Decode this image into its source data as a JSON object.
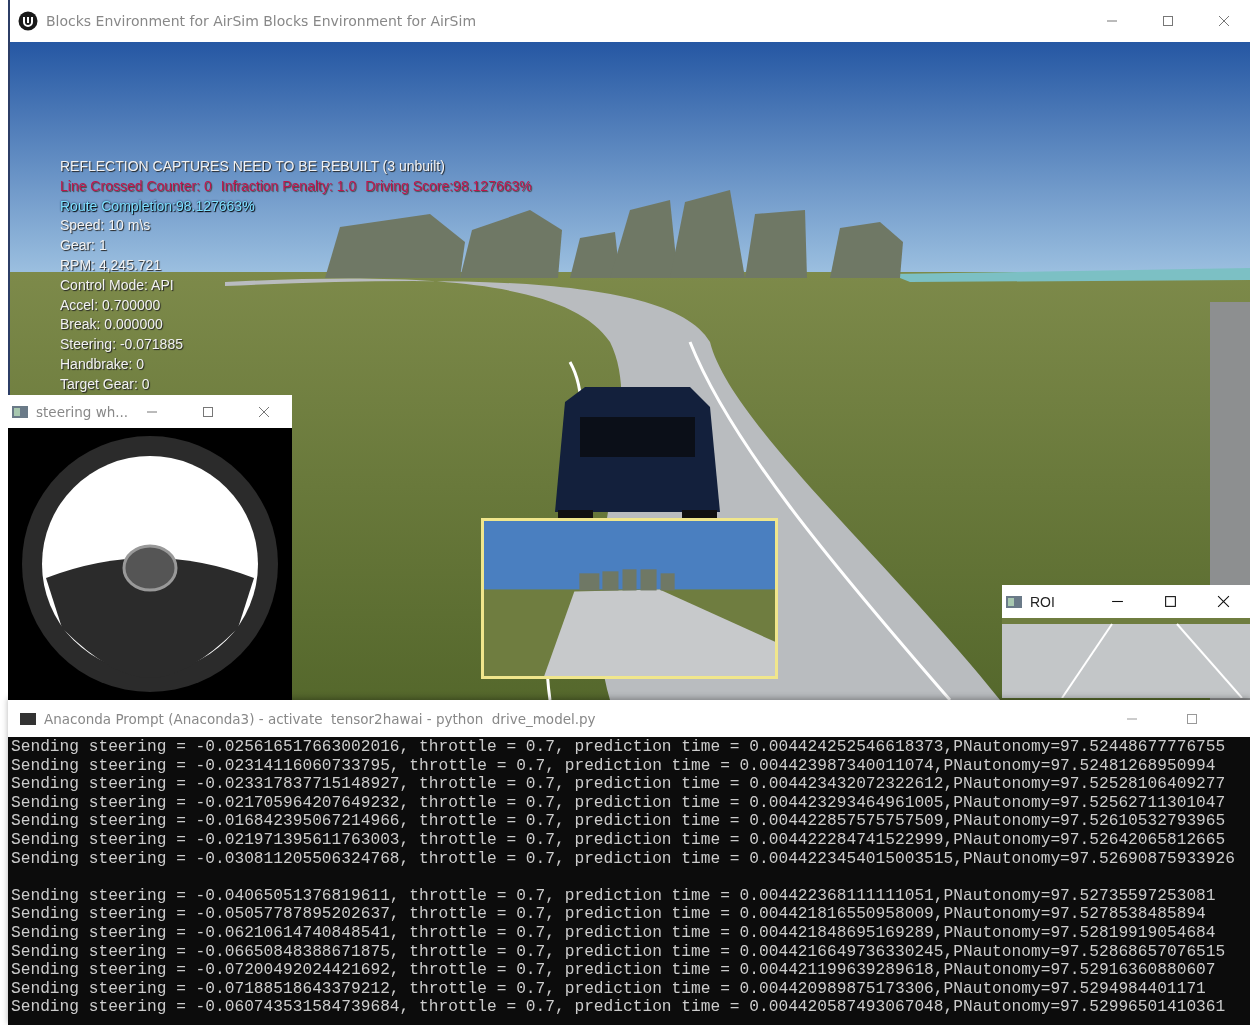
{
  "main_window": {
    "title": "Blocks Environment for AirSim Blocks Environment for AirSim"
  },
  "hud": {
    "warning": "REFLECTION CAPTURES NEED TO BE REBUILT (3 unbuilt)",
    "score_items": [
      "Line Crossed Counter: 0",
      "Infraction Penalty: 1.0",
      "Driving Score:98.127663%"
    ],
    "route_completion": "Route Completion:98.127663%",
    "stats": [
      "Speed: 10 m\\s",
      "Gear: 1",
      "RPM: 4,245.721",
      "Control Mode: API",
      "Accel: 0.700000",
      "Break: 0.000000",
      "Steering: -0.071885",
      "Handbrake: 0",
      "Target Gear: 0"
    ]
  },
  "steering_window": {
    "title": "steering wh..."
  },
  "roi_window": {
    "title": "ROI"
  },
  "terminal": {
    "title": "Anaconda Prompt (Anaconda3) - activate  tensor2hawai - python  drive_model.py",
    "blocks": [
      [
        "Sending steering = -0.025616517663002016, throttle = 0.7, prediction time = 0.004424252546618373,PNautonomy=97.52448677776755",
        "Sending steering = -0.02314116060733795, throttle = 0.7, prediction time = 0.004423987340011074,PNautonomy=97.52481268950994",
        "Sending steering = -0.023317837715148927, throttle = 0.7, prediction time = 0.004423432072322612,PNautonomy=97.52528106409277",
        "Sending steering = -0.021705964207649232, throttle = 0.7, prediction time = 0.004423293464961005,PNautonomy=97.52562711301047",
        "Sending steering = -0.016842395067214966, throttle = 0.7, prediction time = 0.004422857575757509,PNautonomy=97.52610532793965",
        "Sending steering = -0.021971395611763003, throttle = 0.7, prediction time = 0.004422284741522999,PNautonomy=97.52642065812665",
        "Sending steering = -0.030811205506324768, throttle = 0.7, prediction time = 0.0044223454015003515,PNautonomy=97.52690875933926"
      ],
      [
        "Sending steering = -0.04065051376819611, throttle = 0.7, prediction time = 0.004422368111111051,PNautonomy=97.52735597253081",
        "Sending steering = -0.05057787895202637, throttle = 0.7, prediction time = 0.004421816550958009,PNautonomy=97.5278538485894",
        "Sending steering = -0.06210614740848541, throttle = 0.7, prediction time = 0.004421848695169289,PNautonomy=97.52819919054684",
        "Sending steering = -0.06650848388671875, throttle = 0.7, prediction time = 0.0044216649736330245,PNautonomy=97.52868657076515",
        "Sending steering = -0.07200492024421692, throttle = 0.7, prediction time = 0.004421199639289618,PNautonomy=97.52916360880607",
        "Sending steering = -0.07188518643379212, throttle = 0.7, prediction time = 0.004420989875173306,PNautonomy=97.5294984401171",
        "Sending steering = -0.060743531584739684, throttle = 0.7, prediction time = 0.004420587493067048,PNautonomy=97.52996501410361"
      ]
    ]
  }
}
